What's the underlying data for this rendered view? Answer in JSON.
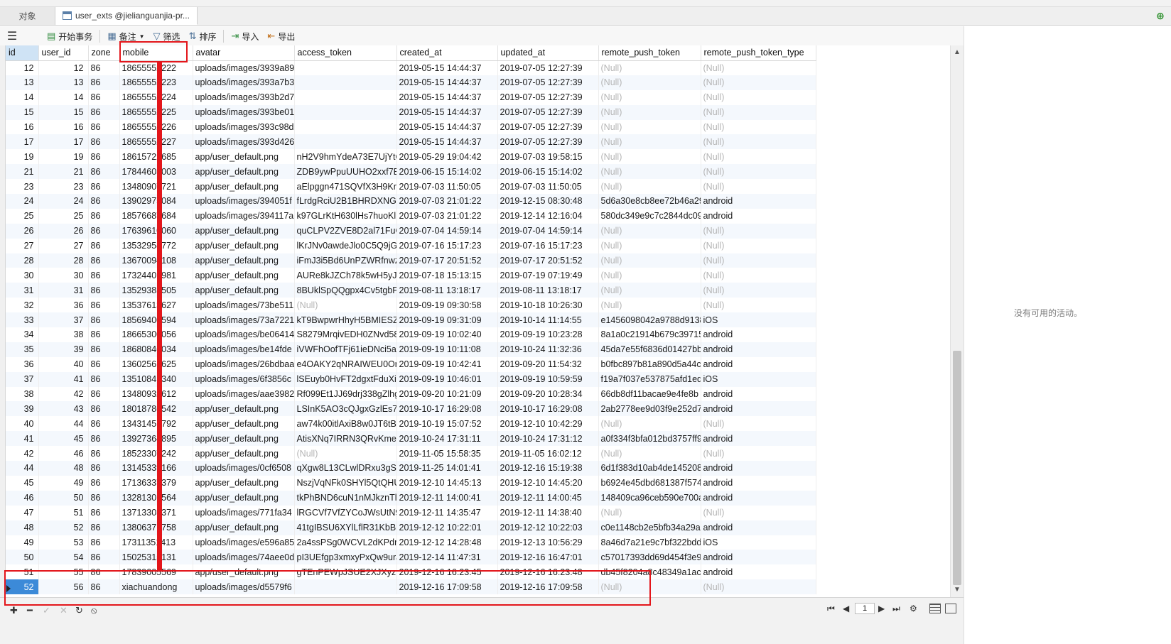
{
  "tabs": {
    "objects_label": "对象",
    "active_label": "user_exts @jielianguanjia-pr..."
  },
  "toolbar": {
    "begin_transaction": "开始事务",
    "note": "备注",
    "filter": "筛选",
    "sort": "排序",
    "import": "导入",
    "export": "导出"
  },
  "columns": [
    "id",
    "user_id",
    "zone",
    "mobile",
    "avatar",
    "access_token",
    "created_at",
    "updated_at",
    "remote_push_token",
    "remote_push_token_type"
  ],
  "rows": [
    [
      "12",
      "12",
      "86",
      "18655552222",
      "uploads/images/3939a89",
      "",
      "2019-05-15 14:44:37",
      "2019-07-05 12:27:39",
      "(Null)",
      "(Null)"
    ],
    [
      "13",
      "13",
      "86",
      "18655552223",
      "uploads/images/393a7b3",
      "",
      "2019-05-15 14:44:37",
      "2019-07-05 12:27:39",
      "(Null)",
      "(Null)"
    ],
    [
      "14",
      "14",
      "86",
      "18655552224",
      "uploads/images/393b2d7",
      "",
      "2019-05-15 14:44:37",
      "2019-07-05 12:27:39",
      "(Null)",
      "(Null)"
    ],
    [
      "15",
      "15",
      "86",
      "18655552225",
      "uploads/images/393be01",
      "",
      "2019-05-15 14:44:37",
      "2019-07-05 12:27:39",
      "(Null)",
      "(Null)"
    ],
    [
      "16",
      "16",
      "86",
      "18655552226",
      "uploads/images/393c98d",
      "",
      "2019-05-15 14:44:37",
      "2019-07-05 12:27:39",
      "(Null)",
      "(Null)"
    ],
    [
      "17",
      "17",
      "86",
      "18655552227",
      "uploads/images/393d426",
      "",
      "2019-05-15 14:44:37",
      "2019-07-05 12:27:39",
      "(Null)",
      "(Null)"
    ],
    [
      "19",
      "19",
      "86",
      "18615722685",
      "app/user_default.png",
      "nH2V9hmYdeA73E7UjYtQ",
      "2019-05-29 19:04:42",
      "2019-07-03 19:58:15",
      "(Null)",
      "(Null)"
    ],
    [
      "21",
      "21",
      "86",
      "17844603003",
      "app/user_default.png",
      "ZDB9ywPpuUUHO2xxf7Ev",
      "2019-06-15 15:14:02",
      "2019-06-15 15:14:02",
      "(Null)",
      "(Null)"
    ],
    [
      "23",
      "23",
      "86",
      "13480907721",
      "app/user_default.png",
      "aElpggn471SQVfX3H9Kr",
      "2019-07-03 11:50:05",
      "2019-07-03 11:50:05",
      "(Null)",
      "(Null)"
    ],
    [
      "24",
      "24",
      "86",
      "13902975084",
      "uploads/images/394051f",
      "fLrdgRciU2B1BHRDXNGw",
      "2019-07-03 21:01:22",
      "2019-12-15 08:30:48",
      "5d6a30e8cb8ee72b46a29",
      "android"
    ],
    [
      "25",
      "25",
      "86",
      "18576687684",
      "uploads/images/394117a",
      "k97GLrKtH630lHs7huoKl",
      "2019-07-03 21:01:22",
      "2019-12-14 12:16:04",
      "580dc349e9c7c2844dc09",
      "android"
    ],
    [
      "26",
      "26",
      "86",
      "17639610060",
      "app/user_default.png",
      "quCLPV2ZVE8D2al71FuGF",
      "2019-07-04 14:59:14",
      "2019-07-04 14:59:14",
      "(Null)",
      "(Null)"
    ],
    [
      "27",
      "27",
      "86",
      "13532958772",
      "app/user_default.png",
      "lKrJNv0awdeJlo0C5Q9jGr",
      "2019-07-16 15:17:23",
      "2019-07-16 15:17:23",
      "(Null)",
      "(Null)"
    ],
    [
      "28",
      "28",
      "86",
      "13670094108",
      "app/user_default.png",
      "iFmJ3i5Bd6UnPZWRfnwzF",
      "2019-07-17 20:51:52",
      "2019-07-17 20:51:52",
      "(Null)",
      "(Null)"
    ],
    [
      "30",
      "30",
      "86",
      "17324401981",
      "app/user_default.png",
      "AURe8kJZCh78k5wH5yJM",
      "2019-07-18 15:13:15",
      "2019-07-19 07:19:49",
      "(Null)",
      "(Null)"
    ],
    [
      "31",
      "31",
      "86",
      "13529385505",
      "app/user_default.png",
      "8BUklSpQQgpx4Cv5tgbPl",
      "2019-08-11 13:18:17",
      "2019-08-11 13:18:17",
      "(Null)",
      "(Null)"
    ],
    [
      "32",
      "36",
      "86",
      "13537613627",
      "uploads/images/73be511",
      "(Null)",
      "2019-09-19 09:30:58",
      "2019-10-18 10:26:30",
      "(Null)",
      "(Null)"
    ],
    [
      "33",
      "37",
      "86",
      "18569400594",
      "uploads/images/73a7221",
      "kT9BwpwrHhyH5BMIESZ2",
      "2019-09-19 09:31:09",
      "2019-10-14 11:14:55",
      "e1456098042a9788d9138",
      "iOS"
    ],
    [
      "34",
      "38",
      "86",
      "18665300056",
      "uploads/images/be06414",
      "S8279MrqivEDH0ZNvd58j",
      "2019-09-19 10:02:40",
      "2019-09-19 10:23:28",
      "8a1a0c21914b679c39715",
      "android"
    ],
    [
      "35",
      "39",
      "86",
      "18680846034",
      "uploads/images/be14fde",
      "iVWFhOofTFj61ieDNci5aU",
      "2019-09-19 10:11:08",
      "2019-10-24 11:32:36",
      "45da7e55f6836d01427bb",
      "android"
    ],
    [
      "36",
      "40",
      "86",
      "13602561625",
      "uploads/images/26bdbaa",
      "e4OAKY2qNRAIWEU0On",
      "2019-09-19 10:42:41",
      "2019-09-20 11:54:32",
      "b0fbc897b81a890d5a44c",
      "android"
    ],
    [
      "37",
      "41",
      "86",
      "13510841340",
      "uploads/images/6f3856c",
      "lSEuyb0HvFT2dgxtFduXiN",
      "2019-09-19 10:46:01",
      "2019-09-19 10:59:59",
      "f19a7f037e537875afd1ed",
      "iOS"
    ],
    [
      "38",
      "42",
      "86",
      "13480932612",
      "uploads/images/aae3982",
      "Rf099Et1JJ69drj338gZlhg",
      "2019-09-20 10:21:09",
      "2019-09-20 10:28:34",
      "66db8df11bacae9e4fe8b",
      "android"
    ],
    [
      "39",
      "43",
      "86",
      "18018786542",
      "app/user_default.png",
      "LSInK5AO3cQJgxGzlEs7G",
      "2019-10-17 16:29:08",
      "2019-10-17 16:29:08",
      "2ab2778ee9d03f9e252d7",
      "android"
    ],
    [
      "40",
      "44",
      "86",
      "13431451792",
      "app/user_default.png",
      "aw74k00itlAxiB8w0JT6tBc",
      "2019-10-19 15:07:52",
      "2019-12-10 10:42:29",
      "(Null)",
      "(Null)"
    ],
    [
      "41",
      "45",
      "86",
      "13927364895",
      "app/user_default.png",
      "AtisXNq7IRRN3QRvKmez",
      "2019-10-24 17:31:11",
      "2019-10-24 17:31:12",
      "a0f334f3bfa012bd3757ff9",
      "android"
    ],
    [
      "42",
      "46",
      "86",
      "18523307242",
      "app/user_default.png",
      "(Null)",
      "2019-11-05 15:58:35",
      "2019-11-05 16:02:12",
      "(Null)",
      "(Null)"
    ],
    [
      "44",
      "48",
      "86",
      "13145339166",
      "uploads/images/0cf6508",
      "qXgw8L13CLwlDRxu3gS1",
      "2019-11-25 14:01:41",
      "2019-12-16 15:19:38",
      "6d1f383d10ab4de145208",
      "android"
    ],
    [
      "45",
      "49",
      "86",
      "17136337379",
      "app/user_default.png",
      "NszjVqNFk0SHYl5QtQHU",
      "2019-12-10 14:45:13",
      "2019-12-10 14:45:20",
      "b6924e45dbd681387f574",
      "android"
    ],
    [
      "46",
      "50",
      "86",
      "13281301564",
      "app/user_default.png",
      "tkPhBND6cuN1nMJkznTlE",
      "2019-12-11 14:00:41",
      "2019-12-11 14:00:45",
      "148409ca96ceb590e700a",
      "android"
    ],
    [
      "47",
      "51",
      "86",
      "13713303371",
      "uploads/images/771fa34",
      "lRGCVf7VfZYCoJWsUtN9s",
      "2019-12-11 14:35:47",
      "2019-12-11 14:38:40",
      "(Null)",
      "(Null)"
    ],
    [
      "48",
      "52",
      "86",
      "13806371758",
      "app/user_default.png",
      "41tgIBSU6XYlLflR31KbBkl",
      "2019-12-12 10:22:01",
      "2019-12-12 10:22:03",
      "c0e1148cb2e5bfb34a29a",
      "android"
    ],
    [
      "49",
      "53",
      "86",
      "17311351413",
      "uploads/images/e596a85",
      "2a4ssPSg0WCVL2dKPdm",
      "2019-12-12 14:28:48",
      "2019-12-13 10:56:29",
      "8a46d7a21e9c7bf322bdd",
      "iOS"
    ],
    [
      "50",
      "54",
      "86",
      "15025315131",
      "uploads/images/74aee0d",
      "pI3UEfgp3xmxyPxQw9urJ",
      "2019-12-14 11:47:31",
      "2019-12-16 16:47:01",
      "c57017393dd69d454f3e9",
      "android"
    ],
    [
      "51",
      "55",
      "86",
      "17839005569",
      "app/user_default.png",
      "gTEnPEWpJSUE2XJXyzEg",
      "2019-12-16 16:23:45",
      "2019-12-16 16:23:48",
      "db45f8204a8c48349a1ac",
      "android"
    ],
    [
      "52",
      "56",
      "86",
      "xiachuandong",
      "uploads/images/d5579f6",
      "",
      "2019-12-16 17:09:58",
      "2019-12-16 17:09:58",
      "(Null)",
      "(Null)"
    ]
  ],
  "selected_row_index": 35,
  "right_panel": {
    "empty_message": "没有可用的活动。"
  },
  "status": {
    "page_number": "1"
  },
  "colors": {
    "highlight": "#e3161b",
    "selection": "#3c8ad8",
    "null_text": "#b5b5b5"
  },
  "icons": {
    "menu": "hamburger-icon",
    "begin_transaction": "transaction-icon",
    "note": "note-icon",
    "filter": "filter-icon",
    "sort": "sort-icon",
    "import": "import-icon",
    "export": "export-icon",
    "new_tab": "new-query-icon"
  }
}
